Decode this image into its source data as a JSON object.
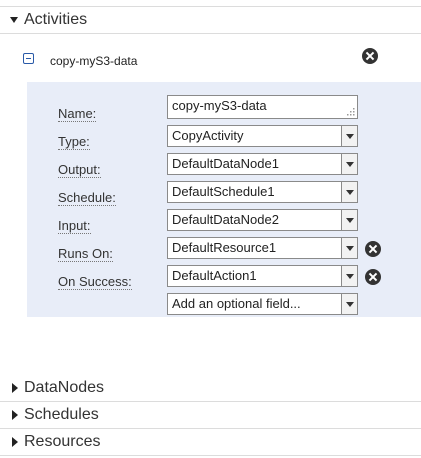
{
  "sections": {
    "activities": "Activities",
    "datanodes": "DataNodes",
    "schedules": "Schedules",
    "resources": "Resources"
  },
  "activity": {
    "title": "copy-myS3-data",
    "fields": {
      "name": {
        "label": "Name:",
        "value": "copy-myS3-data"
      },
      "type": {
        "label": "Type:",
        "value": "CopyActivity"
      },
      "output": {
        "label": "Output:",
        "value": "DefaultDataNode1"
      },
      "schedule": {
        "label": "Schedule:",
        "value": "DefaultSchedule1"
      },
      "input": {
        "label": "Input:",
        "value": "DefaultDataNode2"
      },
      "runs_on": {
        "label": "Runs On:",
        "value": "DefaultResource1"
      },
      "on_success": {
        "label": "On Success:",
        "value": "DefaultAction1"
      },
      "optional": {
        "value": "Add an optional field..."
      }
    }
  },
  "icons": {
    "expanded": "triangle-down-icon",
    "collapsed": "triangle-right-icon",
    "collapse": "minus-box-icon",
    "remove": "x-circle-icon",
    "dropdown": "chevron-down-icon",
    "resize": "resize-grip-icon"
  }
}
